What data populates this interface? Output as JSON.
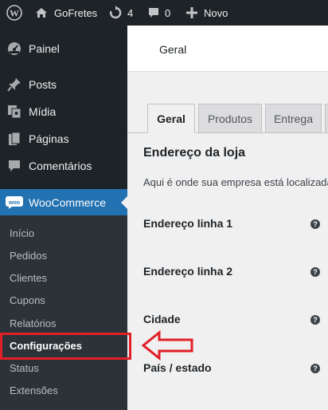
{
  "adminbar": {
    "site_name": "GoFretes",
    "updates_count": "4",
    "comments_count": "0",
    "new_label": "Novo"
  },
  "sidebar": {
    "items": [
      {
        "label": "Painel",
        "icon": "dashboard-icon"
      },
      {
        "label": "Posts",
        "icon": "pin-icon"
      },
      {
        "label": "Mídia",
        "icon": "media-icon"
      },
      {
        "label": "Páginas",
        "icon": "pages-icon"
      },
      {
        "label": "Comentários",
        "icon": "comment-icon"
      },
      {
        "label": "WooCommerce",
        "icon": "woo-icon"
      }
    ],
    "submenu": [
      "Início",
      "Pedidos",
      "Clientes",
      "Cupons",
      "Relatórios",
      "Configurações",
      "Status",
      "Extensões"
    ]
  },
  "header": {
    "title": "Geral"
  },
  "tabs": [
    "Geral",
    "Produtos",
    "Entrega"
  ],
  "section": {
    "title": "Endereço da loja",
    "description": "Aqui é onde sua empresa está localizada"
  },
  "fields": [
    "Endereço linha 1",
    "Endereço linha 2",
    "Cidade",
    "País / estado"
  ],
  "colors": {
    "accent": "#2271b1",
    "highlight": "#e01f26",
    "adminbar": "#1d2327"
  }
}
